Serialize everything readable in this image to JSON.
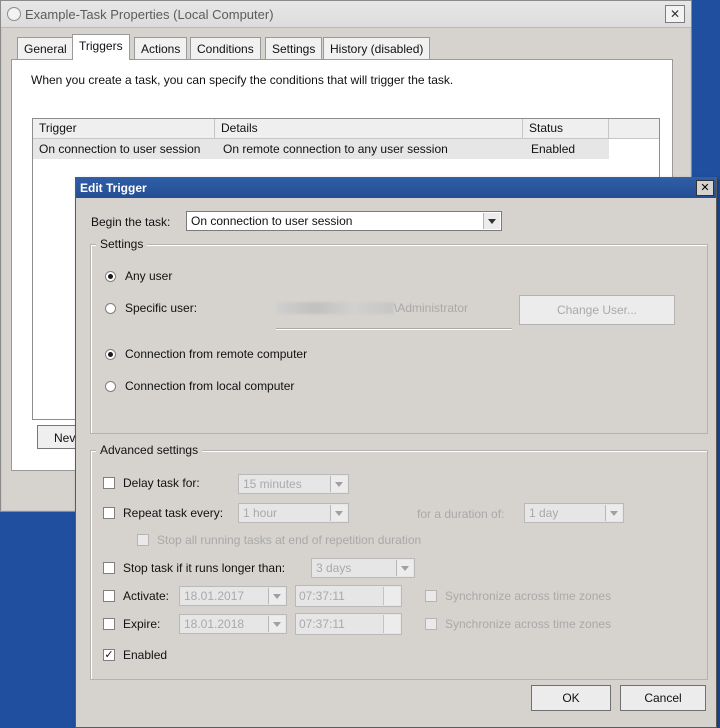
{
  "window": {
    "title": "Example-Task Properties (Local Computer)",
    "close_glyph": "✕",
    "tabs": [
      {
        "label": "General",
        "active": false
      },
      {
        "label": "Triggers",
        "active": true
      },
      {
        "label": "Actions",
        "active": false
      },
      {
        "label": "Conditions",
        "active": false
      },
      {
        "label": "Settings",
        "active": false
      },
      {
        "label": "History (disabled)",
        "active": false
      }
    ],
    "description": "When you create a task, you can specify the conditions that will trigger the task.",
    "table": {
      "headers": [
        "Trigger",
        "Details",
        "Status"
      ],
      "rows": [
        {
          "trigger": "On connection to user session",
          "details": "On remote connection to any user session",
          "status": "Enabled"
        }
      ]
    },
    "new_button": "Nev"
  },
  "dialog": {
    "title": "Edit Trigger",
    "close_glyph": "✕",
    "begin_label": "Begin the task:",
    "begin_value": "On connection to user session",
    "settings": {
      "legend": "Settings",
      "any_user": "Any user",
      "specific_user": "Specific user:",
      "user_suffix": "\\Administrator",
      "change_user_button": "Change User...",
      "remote": "Connection from remote computer",
      "local": "Connection from local computer"
    },
    "advanced": {
      "legend": "Advanced settings",
      "delay_label": "Delay task for:",
      "delay_value": "15 minutes",
      "repeat_label": "Repeat task every:",
      "repeat_value": "1 hour",
      "duration_label": "for a duration of:",
      "duration_value": "1 day",
      "stop_running": "Stop all running tasks at end of repetition duration",
      "stop_longer_label": "Stop task if it runs longer than:",
      "stop_longer_value": "3 days",
      "activate_label": "Activate:",
      "activate_date": "18.01.2017",
      "activate_time": "07:37:11",
      "expire_label": "Expire:",
      "expire_date": "18.01.2018",
      "expire_time": "07:37:11",
      "sync_label": "Synchronize across time zones",
      "enabled_label": "Enabled",
      "check_glyph": "✓"
    },
    "ok_button": "OK",
    "cancel_button": "Cancel"
  }
}
